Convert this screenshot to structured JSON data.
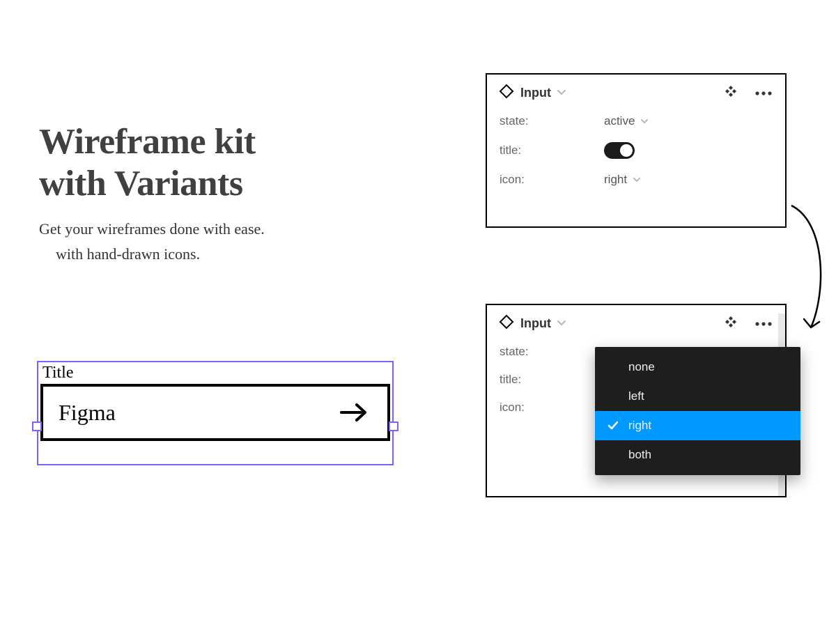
{
  "hero": {
    "title_line1": "Wireframe kit",
    "title_line2": "with Variants",
    "sub_line1": "Get your wireframes done with ease.",
    "sub_line2": "with hand-drawn icons."
  },
  "wireframe_input": {
    "title_label": "Title",
    "value": "Figma",
    "icon": "arrow-right"
  },
  "panel_top": {
    "component_name": "Input",
    "props": {
      "state": {
        "label": "state:",
        "value": "active"
      },
      "title": {
        "label": "title:",
        "toggle_on": true
      },
      "icon": {
        "label": "icon:",
        "value": "right"
      }
    }
  },
  "panel_bottom": {
    "component_name": "Input",
    "props": {
      "state": {
        "label": "state:"
      },
      "title": {
        "label": "title:"
      },
      "icon": {
        "label": "icon:"
      }
    },
    "dropdown": {
      "options": [
        "none",
        "left",
        "right",
        "both"
      ],
      "selected": "right"
    }
  },
  "colors": {
    "selection": "#7b61ff",
    "dropdown_highlight": "#0099ff"
  }
}
